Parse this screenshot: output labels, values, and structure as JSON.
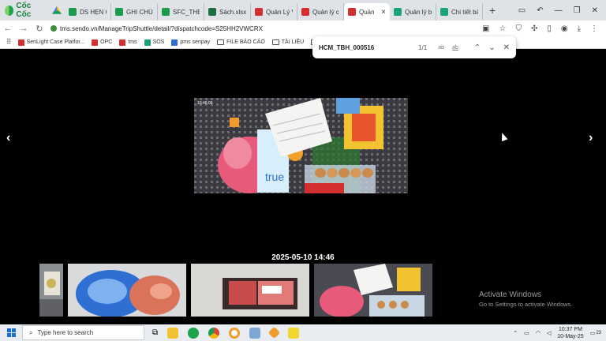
{
  "browser": {
    "brand_name": "Cốc Cốc",
    "tabs": [
      {
        "label": "DS HẸN G",
        "icon_color": "#1a9c4a"
      },
      {
        "label": "GHI CHÚ",
        "icon_color": "#1a9c4a"
      },
      {
        "label": "SFC_THEO",
        "icon_color": "#1a9c4a"
      },
      {
        "label": "Sách.xlsx",
        "icon_color": "#1d6f42"
      },
      {
        "label": "Quản Lý V",
        "icon_color": "#d32f2f"
      },
      {
        "label": "Quản lý ch",
        "icon_color": "#d32f2f"
      },
      {
        "label": "Quản",
        "icon_color": "#d32f2f",
        "active": true
      },
      {
        "label": "Quản lý bả",
        "icon_color": "#1aa37a"
      },
      {
        "label": "Chi tiết bả",
        "icon_color": "#1aa37a"
      }
    ],
    "tab_close_glyph": "×",
    "new_tab_glyph": "+",
    "url": "tms.sendo.vn/ManageTripShuttle/detail/?dispatchcode=S25HH2VWCRX",
    "bookmarks": [
      {
        "label": "SenLight Case Platfor...",
        "type": "site",
        "color": "#d32f2f"
      },
      {
        "label": "OPC",
        "type": "site",
        "color": "#d32f2f"
      },
      {
        "label": "tms",
        "type": "site",
        "color": "#d32f2f"
      },
      {
        "label": "SOS",
        "type": "site",
        "color": "#1aa37a"
      },
      {
        "label": "pms senpay",
        "type": "site",
        "color": "#2f6fd1"
      },
      {
        "label": "FILE BÁO CÁO",
        "type": "folder"
      },
      {
        "label": "TÀI LIỆU",
        "type": "folder"
      },
      {
        "label": "FILE C",
        "type": "folder"
      }
    ]
  },
  "find_bar": {
    "query": "HCM_TBH_000516",
    "count": "1/1",
    "match_case_label": "ab",
    "whole_word_label": "ab"
  },
  "viewer": {
    "prev_glyph": "‹",
    "next_glyph": "›",
    "timestamp": "2025-05-10 14:46",
    "photo_caption_small": "10:46:09"
  },
  "watermark": {
    "title": "Activate Windows",
    "subtitle": "Go to Settings to activate Windows."
  },
  "taskbar": {
    "search_placeholder": "Type here to search",
    "time": "10:37 PM",
    "date": "10-May-25",
    "notification_count": "23"
  }
}
